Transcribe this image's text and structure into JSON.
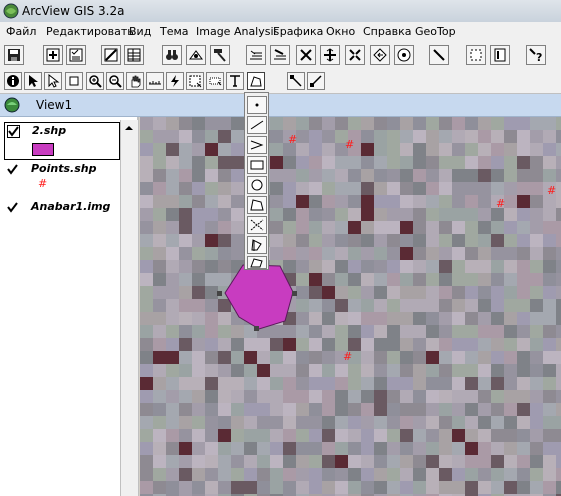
{
  "window": {
    "title": "ArcView GIS 3.2a"
  },
  "menu": [
    "Файл",
    "Редактировать",
    "Вид",
    "Тема",
    "Image Analysis",
    "Графика",
    "Окно",
    "Справка",
    "GeoTop"
  ],
  "view": {
    "title": "View1"
  },
  "themes": [
    {
      "name": "2.shp",
      "checked": true,
      "symbol": "polygon",
      "color": "#c83cc0"
    },
    {
      "name": "Points.shp",
      "checked": true,
      "symbol": "point-hash",
      "marker": "#"
    },
    {
      "name": "Anabar1.img",
      "checked": true,
      "symbol": "image"
    }
  ],
  "map": {
    "point_marker": "#",
    "marker_color": "#ff1a1a",
    "polygon_color": "#c83cc0"
  },
  "colors": {
    "title_bg": "#dfe4ea",
    "view_title_bg": "#c7d9ef",
    "toolbar_bg": "#f0f0f0"
  }
}
